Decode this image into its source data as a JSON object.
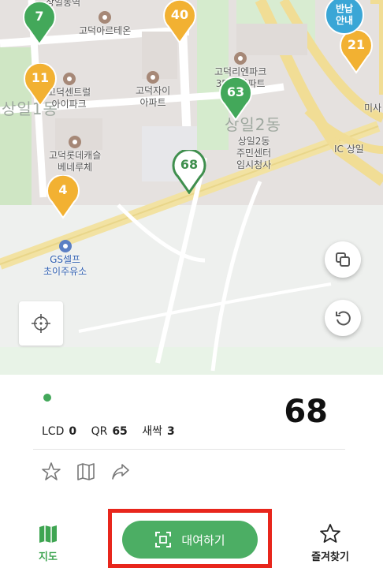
{
  "map": {
    "district_labels": [
      "상일1동",
      "상일2동"
    ],
    "places": [
      {
        "name": "고덕아르테온",
        "icon": "building-icon"
      },
      {
        "name": "고덕센트럴\n아이파크",
        "icon": "building-icon"
      },
      {
        "name": "고덕자이\n아파트",
        "icon": "building-icon"
      },
      {
        "name": "고덕리엔파크\n3단지아파트",
        "icon": "building-icon"
      },
      {
        "name": "고덕롯데캐슬\n베네루체",
        "icon": "building-icon"
      },
      {
        "name": "상일2동\n주민센터\n임시청사",
        "icon": ""
      },
      {
        "name": "GS셀프\n초이주유소",
        "icon": "gas-station-icon"
      },
      {
        "name": "상일동역",
        "icon": ""
      },
      {
        "name": "IC 상일",
        "icon": ""
      },
      {
        "name": "미사",
        "icon": ""
      }
    ],
    "station_markers": [
      {
        "count": "7",
        "color": "#43a85a"
      },
      {
        "count": "40",
        "color": "#f2b132"
      },
      {
        "count": "11",
        "color": "#f2b132"
      },
      {
        "count": "63",
        "color": "#43a85a"
      },
      {
        "count": "68",
        "color": "#43a85a",
        "selected": true
      },
      {
        "count": "4",
        "color": "#f2b132"
      },
      {
        "count": "21",
        "color": "#f2b132"
      }
    ],
    "notice_badge": {
      "line1": "반납",
      "line2": "안내",
      "color": "#3aa6d6"
    },
    "buttons": {
      "layers": "layers-icon",
      "refresh": "refresh-icon",
      "locate": "crosshair-icon"
    }
  },
  "station_info": {
    "status_dot_color": "#43a85a",
    "total": "68",
    "counts": [
      {
        "label": "LCD",
        "value": "0"
      },
      {
        "label": "QR",
        "value": "65"
      },
      {
        "label": "새싹",
        "value": "3"
      }
    ],
    "actions": [
      "star-icon",
      "map-book-icon",
      "share-icon"
    ]
  },
  "tabbar": {
    "map_label": "지도",
    "rent_label": "대여하기",
    "favorites_label": "즐겨찾기",
    "accent": "#4cae64",
    "highlight": "#e8261c"
  }
}
